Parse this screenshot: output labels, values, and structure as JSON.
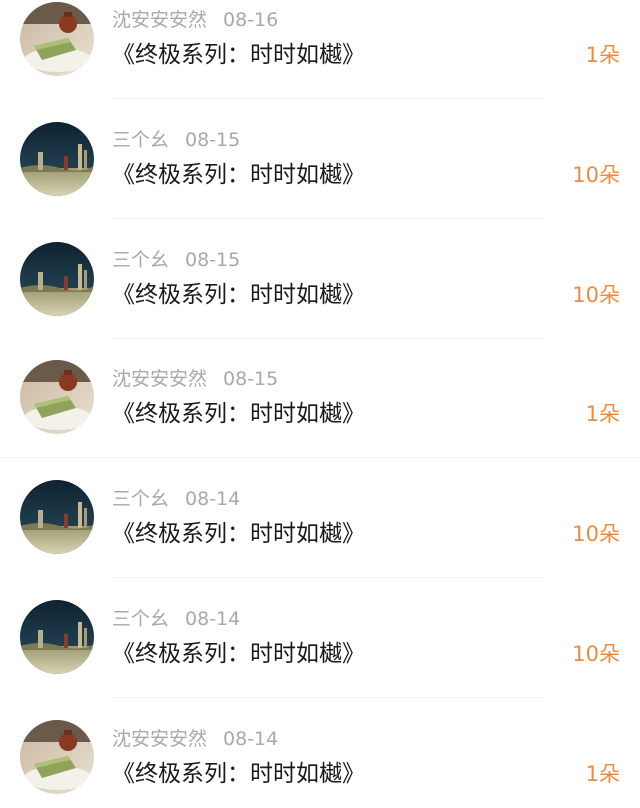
{
  "items": [
    {
      "user": "沈安安安然",
      "date": "08-16",
      "title": "《终极系列：时时如樾》",
      "count": "1朵",
      "avatar_icon": "tea-cake-avatar"
    },
    {
      "user": "三个幺",
      "date": "08-15",
      "title": "《终极系列：时时如樾》",
      "count": "10朵",
      "avatar_icon": "grassland-avatar"
    },
    {
      "user": "三个幺",
      "date": "08-15",
      "title": "《终极系列：时时如樾》",
      "count": "10朵",
      "avatar_icon": "grassland-avatar"
    },
    {
      "user": "沈安安安然",
      "date": "08-15",
      "title": "《终极系列：时时如樾》",
      "count": "1朵",
      "avatar_icon": "tea-cake-avatar"
    },
    {
      "user": "三个幺",
      "date": "08-14",
      "title": "《终极系列：时时如樾》",
      "count": "10朵",
      "avatar_icon": "grassland-avatar"
    },
    {
      "user": "三个幺",
      "date": "08-14",
      "title": "《终极系列：时时如樾》",
      "count": "10朵",
      "avatar_icon": "grassland-avatar"
    },
    {
      "user": "沈安安安然",
      "date": "08-14",
      "title": "《终极系列：时时如樾》",
      "count": "1朵",
      "avatar_icon": "tea-cake-avatar"
    }
  ],
  "colors": {
    "username": "#a9a9a9",
    "title": "#1a1a1a",
    "count": "#f08a3e",
    "divider": "#f0f0f0"
  }
}
